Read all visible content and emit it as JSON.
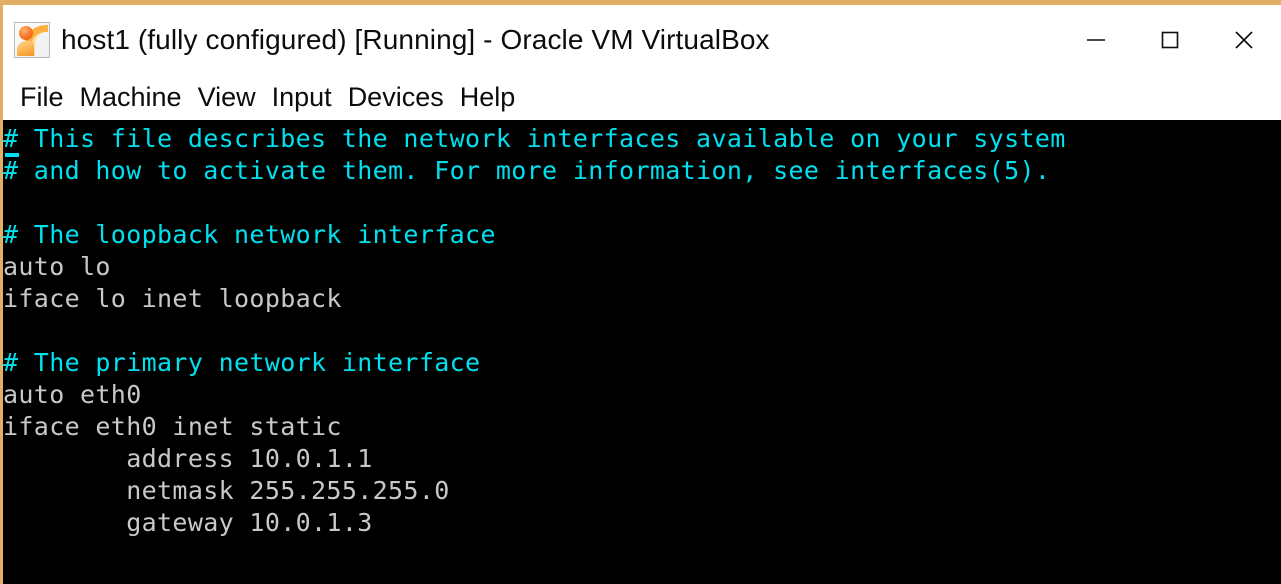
{
  "window": {
    "title": "host1 (fully configured) [Running] - Oracle VM VirtualBox",
    "icon": "virtualbox-icon",
    "border_color": "#e0ae64",
    "controls": [
      {
        "name": "minimize",
        "glyph": "minimize-icon"
      },
      {
        "name": "maximize",
        "glyph": "maximize-icon"
      },
      {
        "name": "close",
        "glyph": "close-icon"
      }
    ]
  },
  "menu": {
    "items": [
      {
        "label": "File"
      },
      {
        "label": "Machine"
      },
      {
        "label": "View"
      },
      {
        "label": "Input"
      },
      {
        "label": "Devices"
      },
      {
        "label": "Help"
      }
    ]
  },
  "terminal": {
    "background": "#000000",
    "comment_color": "#00e0ee",
    "text_color": "#c8c8c8",
    "cursor": "block-underline-cursor",
    "lines": [
      {
        "type": "comment",
        "text": "# This file describes the network interfaces available on your system"
      },
      {
        "type": "comment",
        "text": "# and how to activate them. For more information, see interfaces(5)."
      },
      {
        "type": "blank",
        "text": ""
      },
      {
        "type": "comment",
        "text": "# The loopback network interface"
      },
      {
        "type": "text",
        "text": "auto lo"
      },
      {
        "type": "text",
        "text": "iface lo inet loopback"
      },
      {
        "type": "blank",
        "text": ""
      },
      {
        "type": "comment",
        "text": "# The primary network interface"
      },
      {
        "type": "text",
        "text": "auto eth0"
      },
      {
        "type": "text",
        "text": "iface eth0 inet static"
      },
      {
        "type": "text",
        "text": "        address 10.0.1.1"
      },
      {
        "type": "text",
        "text": "        netmask 255.255.255.0"
      },
      {
        "type": "text",
        "text": "        gateway 10.0.1.3"
      }
    ],
    "partial_glyph": "~"
  }
}
